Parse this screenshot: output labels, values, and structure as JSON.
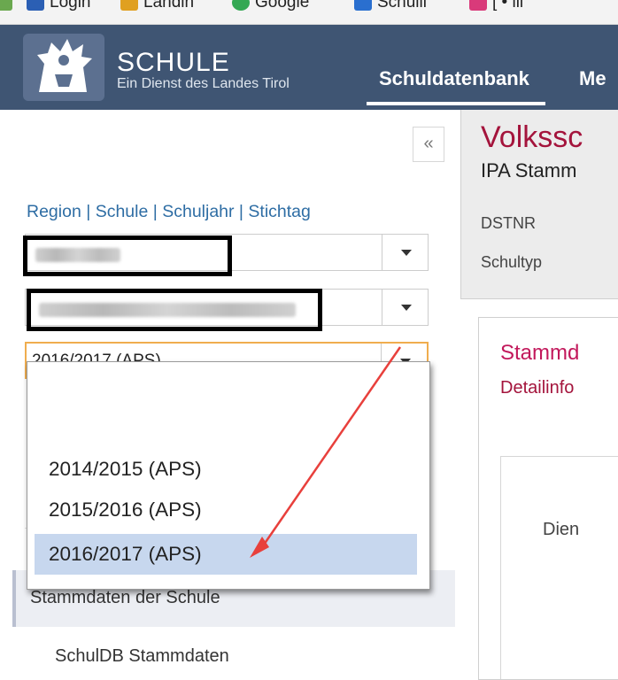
{
  "bookmarks": [
    {
      "label": "Login",
      "color": "#2b5fb4"
    },
    {
      "label": "Landin",
      "color": "#e0a020"
    },
    {
      "label": "Google",
      "color": "#34a853"
    },
    {
      "label": "Schulli",
      "color": "#2a6fcf"
    },
    {
      "label": "[ • lli",
      "color": "#d93a7a"
    }
  ],
  "header": {
    "brand_title": "SCHULE",
    "brand_subtitle": "Ein Dienst des Landes Tirol",
    "nav_active": "Schuldatenbank",
    "nav_next": "Me"
  },
  "sidebar": {
    "collapse_glyph": "«",
    "filter_label": "Region | Schule | Schuljahr | Stichtag",
    "selects": {
      "schuljahr_value": "2016/2017 (APS)"
    },
    "dropdown_options": [
      "2014/2015 (APS)",
      "2015/2016 (APS)",
      "2016/2017 (APS)"
    ],
    "nav_item": "Stammdaten der Schule",
    "nav_subitem": "SchulDB Stammdaten"
  },
  "school": {
    "title": "Volkssc",
    "subtitle": "IPA Stamm",
    "meta_dstnr": "DSTNR",
    "meta_schultyp": "Schultyp"
  },
  "content": {
    "title": "Stammd",
    "subtitle": "Detailinfo",
    "body_text": "Dien"
  },
  "colors": {
    "header_bg": "#3f5573",
    "link_blue": "#2e6da4",
    "accent_crimson": "#a4143c",
    "annotation_arrow": "#e8403c"
  }
}
